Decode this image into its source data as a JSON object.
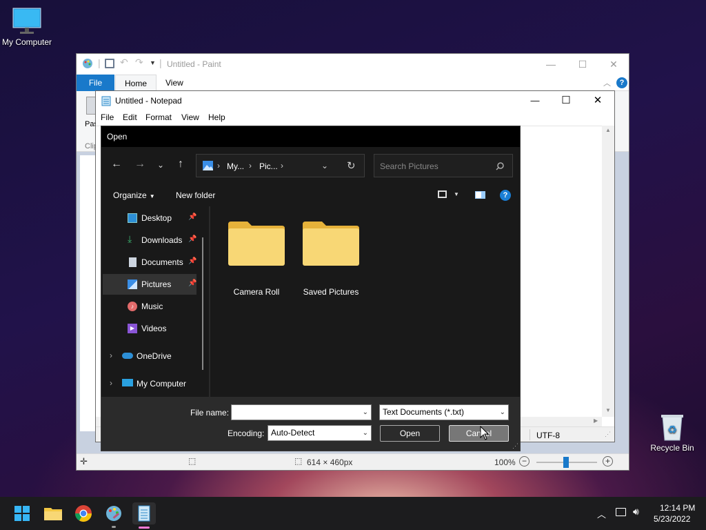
{
  "desktop": {
    "icons": [
      {
        "label": "My Computer"
      },
      {
        "label": "Recycle Bin"
      }
    ]
  },
  "paint": {
    "title": "Untitled - Paint",
    "tabs": [
      "File",
      "Home",
      "View"
    ],
    "ribbon_partial": {
      "paste": "Pas",
      "clipboard": "Clip"
    },
    "status": {
      "size": "614 × 460px",
      "zoom": "100%"
    }
  },
  "notepad": {
    "title": "Untitled - Notepad",
    "menu": [
      "File",
      "Edit",
      "Format",
      "View",
      "Help"
    ],
    "encoding_status": "UTF-8"
  },
  "dialog": {
    "title": "Open",
    "breadcrumb": [
      "My...",
      "Pic..."
    ],
    "search_placeholder": "Search Pictures",
    "organize": "Organize",
    "new_folder": "New folder",
    "nav": [
      {
        "label": "Desktop",
        "pinned": true
      },
      {
        "label": "Downloads",
        "pinned": true
      },
      {
        "label": "Documents",
        "pinned": true
      },
      {
        "label": "Pictures",
        "pinned": true,
        "selected": true
      },
      {
        "label": "Music",
        "pinned": false
      },
      {
        "label": "Videos",
        "pinned": false
      },
      {
        "label": "OneDrive",
        "expandable": true
      },
      {
        "label": "My Computer",
        "expandable": true
      }
    ],
    "folders": [
      "Camera Roll",
      "Saved Pictures"
    ],
    "file_name_label": "File name:",
    "file_name_value": "",
    "file_type": "Text Documents (*.txt)",
    "encoding_label": "Encoding:",
    "encoding_value": "Auto-Detect",
    "open_button": "Open",
    "cancel_button": "Cancel"
  },
  "taskbar": {
    "apps": [
      "start-icon",
      "file-explorer-icon",
      "chrome-icon",
      "paint-icon",
      "notepad-icon"
    ],
    "time": "12:14 PM",
    "date": "5/23/2022"
  },
  "colors": {
    "dialog_bg": "#191919",
    "accent": "#0078d4",
    "folder_yellow": "#f8d775"
  }
}
